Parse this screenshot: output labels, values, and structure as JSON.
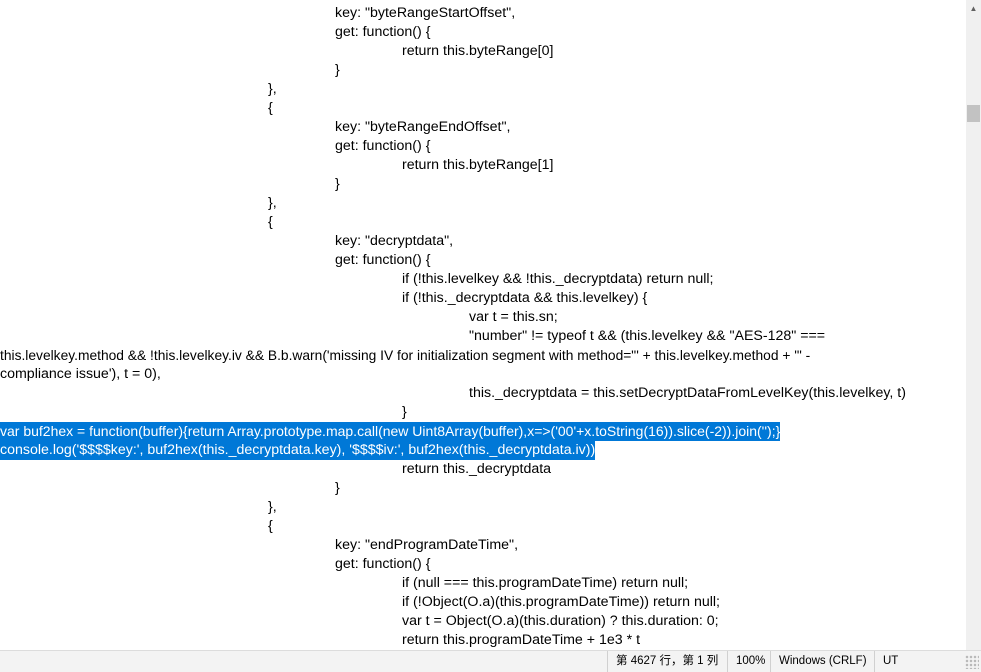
{
  "editor": {
    "lines": [
      "key: \"byteRangeStartOffset\",",
      "get: function() {",
      "return this.byteRange[0]",
      "}",
      "},",
      "{",
      "key: \"byteRangeEndOffset\",",
      "get: function() {",
      "return this.byteRange[1]",
      "}",
      "},",
      "{",
      "key: \"decryptdata\",",
      "get: function() {",
      "if (!this.levelkey && !this._decryptdata) return null;",
      "if (!this._decryptdata && this.levelkey) {",
      "var t = this.sn;",
      "\"number\" != typeof t && (this.levelkey && \"AES-128\" ===",
      "this.levelkey.method && !this.levelkey.iv && B.b.warn('missing IV for initialization segment with method=\"' + this.levelkey.method + '\" -",
      "compliance issue'), t = 0),",
      "this._decryptdata = this.setDecryptDataFromLevelKey(this.levelkey, t)",
      "}",
      "var buf2hex = function(buffer){return Array.prototype.map.call(new Uint8Array(buffer),x=>('00'+x.toString(16)).slice(-2)).join('');}",
      "console.log('$$$$key:', buf2hex(this._decryptdata.key), '$$$$iv:', buf2hex(this._decryptdata.iv))",
      "return this._decryptdata",
      "}",
      "},",
      "{",
      "key: \"endProgramDateTime\",",
      "get: function() {",
      "if (null === this.programDateTime) return null;",
      "if (!Object(O.a)(this.programDateTime)) return null;",
      "var t = Object(O.a)(this.duration) ? this.duration: 0;",
      "return this.programDateTime + 1e3 * t"
    ]
  },
  "statusbar": {
    "position": "第 4627 行，第 1 列",
    "zoom": "100%",
    "line_ending": "Windows (CRLF)",
    "encoding": "UT"
  }
}
